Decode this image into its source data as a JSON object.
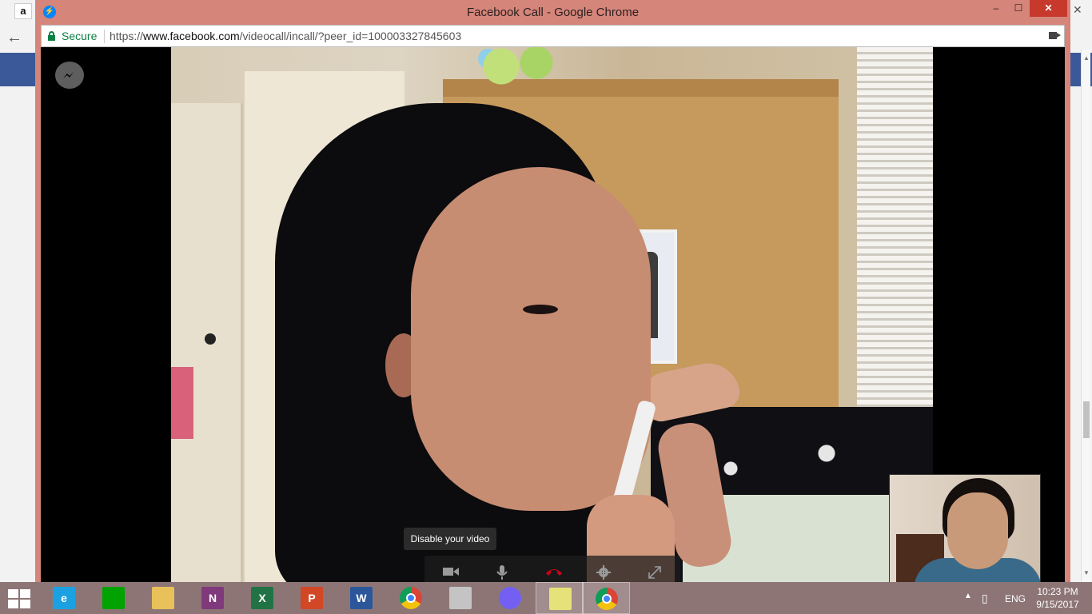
{
  "window": {
    "title": "Facebook Call - Google Chrome",
    "minimize": "–",
    "maximize": "☐",
    "close": "✕"
  },
  "address_bar": {
    "security_label": "Secure",
    "url_scheme": "https://",
    "url_host": "www.facebook.com",
    "url_path": "/videocall/incall/?peer_id=100003327845603"
  },
  "call": {
    "tooltip": "Disable your video",
    "controls": [
      "video-camera-icon",
      "microphone-icon",
      "end-call-icon",
      "settings-gear-icon",
      "fullscreen-expand-icon"
    ],
    "end_call_color": "#d0021b"
  },
  "background_tab": {
    "favicon": "a"
  },
  "taskbar": {
    "apps": [
      {
        "name": "internet-explorer",
        "label": "e",
        "color": "#1ba1e2"
      },
      {
        "name": "windows-store",
        "label": "",
        "color": "#00a300"
      },
      {
        "name": "file-explorer",
        "label": "",
        "color": "#e8c15a"
      },
      {
        "name": "onenote",
        "label": "N",
        "color": "#80397b"
      },
      {
        "name": "excel",
        "label": "X",
        "color": "#217346"
      },
      {
        "name": "powerpoint",
        "label": "P",
        "color": "#d24726"
      },
      {
        "name": "word",
        "label": "W",
        "color": "#2b579a"
      },
      {
        "name": "chrome",
        "label": "",
        "color": "#db4437"
      },
      {
        "name": "snipping-tool",
        "label": "",
        "color": "#c4c4c4"
      },
      {
        "name": "viber",
        "label": "",
        "color": "#7360f2"
      },
      {
        "name": "sticky-notes",
        "label": "",
        "color": "#e6e27a"
      },
      {
        "name": "chrome-active",
        "label": "",
        "color": "#db4437"
      }
    ],
    "language": "ENG",
    "time": "10:23 PM",
    "date": "9/15/2017"
  }
}
